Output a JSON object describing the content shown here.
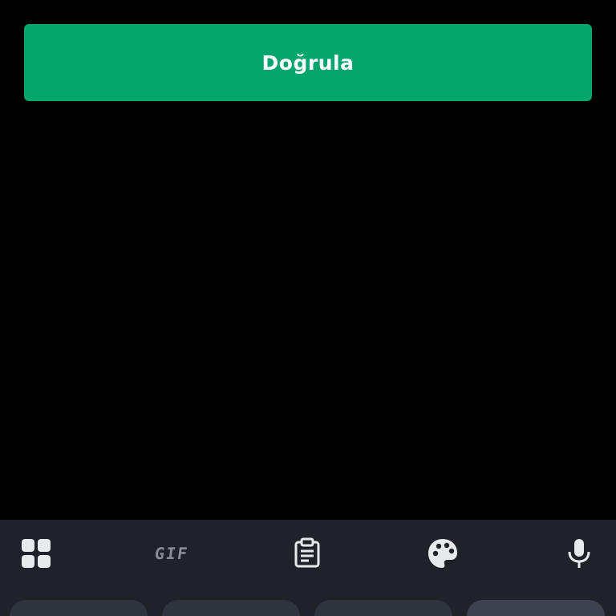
{
  "verify_button": {
    "label": "Doğrula",
    "color": "#05a56e"
  },
  "keyboard": {
    "background": "#1f2229",
    "toolbar": [
      {
        "name": "grid-icon",
        "label": ""
      },
      {
        "name": "gif-icon",
        "label": "GIF"
      },
      {
        "name": "clipboard-icon",
        "label": ""
      },
      {
        "name": "palette-icon",
        "label": ""
      },
      {
        "name": "microphone-icon",
        "label": ""
      }
    ],
    "suggestion_count": 4
  }
}
